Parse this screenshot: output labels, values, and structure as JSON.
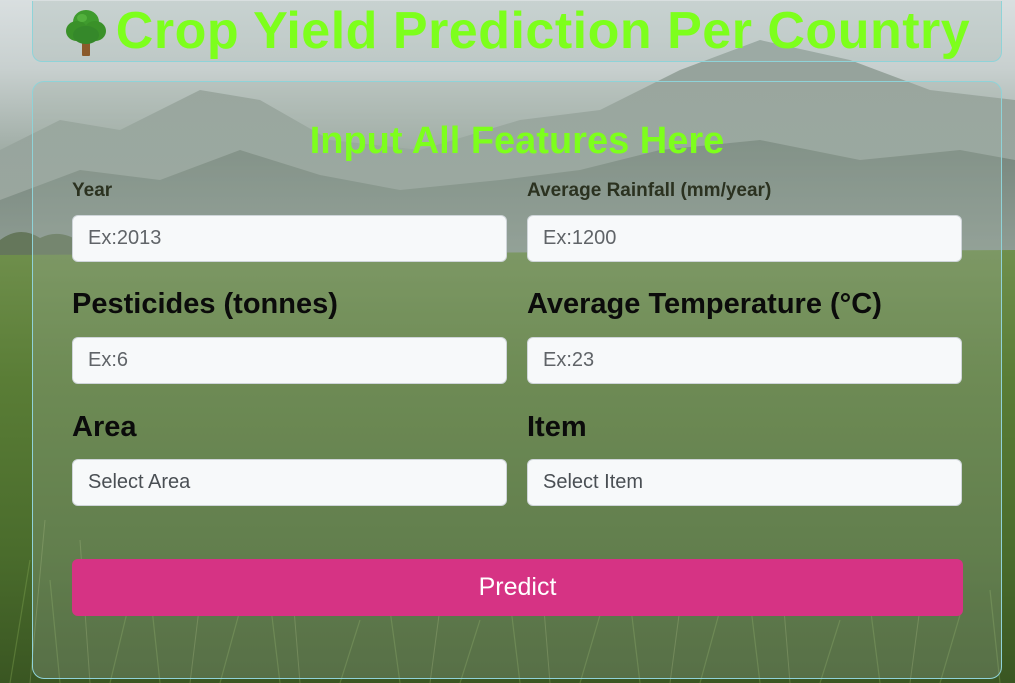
{
  "header": {
    "icon": "tree-icon",
    "title": "Crop Yield Prediction Per Country"
  },
  "form": {
    "title": "Input All Features Here",
    "fields": {
      "year": {
        "label": "Year",
        "placeholder": "Ex:2013"
      },
      "rainfall": {
        "label": "Average Rainfall (mm/year)",
        "placeholder": "Ex:1200"
      },
      "pesticides": {
        "label": "Pesticides (tonnes)",
        "placeholder": "Ex:6"
      },
      "temperature": {
        "label": "Average Temperature (°C)",
        "placeholder": "Ex:23"
      },
      "area": {
        "label": "Area",
        "selected": "Select Area"
      },
      "item": {
        "label": "Item",
        "selected": "Select Item"
      }
    },
    "submit_label": "Predict"
  },
  "colors": {
    "accent_green": "#7dff1c",
    "button": "#d63384",
    "panel_border": "#8fd3d8"
  }
}
